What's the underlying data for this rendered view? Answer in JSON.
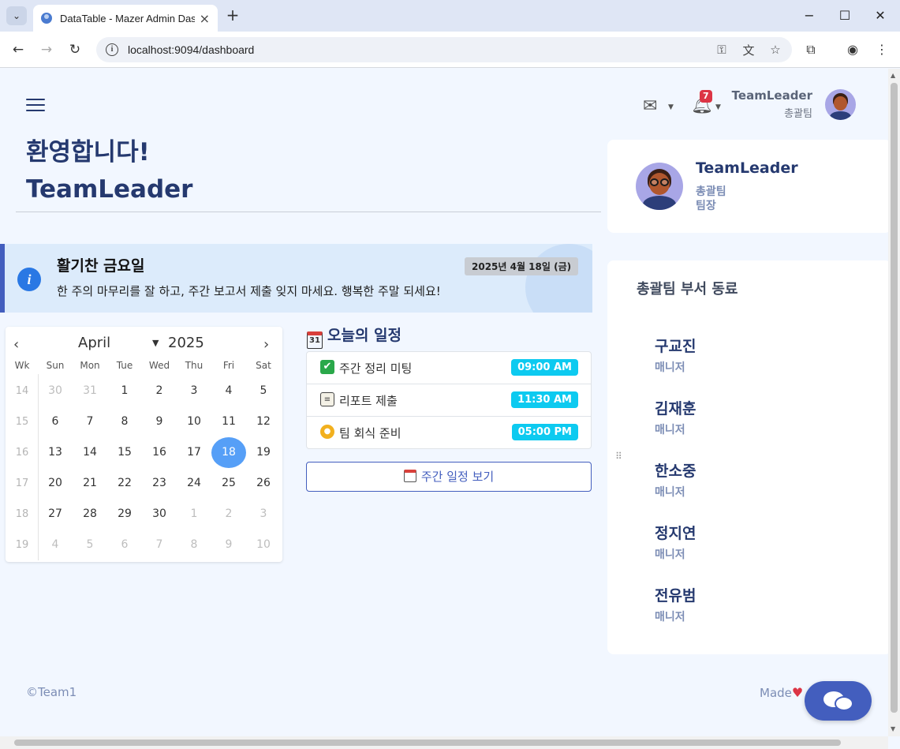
{
  "browser": {
    "tab_title": "DataTable - Mazer Admin Dashboard",
    "url": "localhost:9094/dashboard"
  },
  "header": {
    "notification_count": "7",
    "user_name": "TeamLeader",
    "user_team": "총괄팀"
  },
  "welcome": {
    "greeting": "환영합니다!",
    "name": "TeamLeader"
  },
  "alert": {
    "title": "활기찬 금요일",
    "message": "한 주의 마무리를 잘 하고, 주간 보고서 제출 잊지 마세요. 행복한 주말 되세요!",
    "date": "2025년 4월 18일 (금)"
  },
  "calendar": {
    "month": "April",
    "year": "2025",
    "headers": [
      "Wk",
      "Sun",
      "Mon",
      "Tue",
      "Wed",
      "Thu",
      "Fri",
      "Sat"
    ],
    "selected_day": "18",
    "weeks": [
      {
        "wk": "14",
        "days": [
          [
            "30",
            true
          ],
          [
            "31",
            true
          ],
          [
            "1",
            false
          ],
          [
            "2",
            false
          ],
          [
            "3",
            false
          ],
          [
            "4",
            false
          ],
          [
            "5",
            false
          ]
        ]
      },
      {
        "wk": "15",
        "days": [
          [
            "6",
            false
          ],
          [
            "7",
            false
          ],
          [
            "8",
            false
          ],
          [
            "9",
            false
          ],
          [
            "10",
            false
          ],
          [
            "11",
            false
          ],
          [
            "12",
            false
          ]
        ]
      },
      {
        "wk": "16",
        "days": [
          [
            "13",
            false
          ],
          [
            "14",
            false
          ],
          [
            "15",
            false
          ],
          [
            "16",
            false
          ],
          [
            "17",
            false
          ],
          [
            "18",
            false
          ],
          [
            "19",
            false
          ]
        ]
      },
      {
        "wk": "17",
        "days": [
          [
            "20",
            false
          ],
          [
            "21",
            false
          ],
          [
            "22",
            false
          ],
          [
            "23",
            false
          ],
          [
            "24",
            false
          ],
          [
            "25",
            false
          ],
          [
            "26",
            false
          ]
        ]
      },
      {
        "wk": "18",
        "days": [
          [
            "27",
            false
          ],
          [
            "28",
            false
          ],
          [
            "29",
            false
          ],
          [
            "30",
            false
          ],
          [
            "1",
            true
          ],
          [
            "2",
            true
          ],
          [
            "3",
            true
          ]
        ]
      },
      {
        "wk": "19",
        "days": [
          [
            "4",
            true
          ],
          [
            "5",
            true
          ],
          [
            "6",
            true
          ],
          [
            "7",
            true
          ],
          [
            "8",
            true
          ],
          [
            "9",
            true
          ],
          [
            "10",
            true
          ]
        ]
      }
    ]
  },
  "schedule": {
    "title": "오늘의 일정",
    "title_icon_text": "31",
    "items": [
      {
        "label": "주간 정리 미팅",
        "time": "09:00 AM",
        "icon": "check-icon"
      },
      {
        "label": "리포트 제출",
        "time": "11:30 AM",
        "icon": "document-icon"
      },
      {
        "label": "팀 회식 준비",
        "time": "05:00 PM",
        "icon": "beer-icon"
      }
    ],
    "week_button": "주간 일정 보기"
  },
  "profile": {
    "name": "TeamLeader",
    "team": "총괄팀",
    "role": "팀장"
  },
  "colleagues": {
    "title": "총괄팀 부서 동료",
    "list": [
      {
        "name": "구교진",
        "role": "매니저"
      },
      {
        "name": "김재훈",
        "role": "매니저"
      },
      {
        "name": "한소중",
        "role": "매니저"
      },
      {
        "name": "정지연",
        "role": "매니저"
      },
      {
        "name": "전유범",
        "role": "매니저"
      }
    ]
  },
  "footer": {
    "copyright": "©Team1",
    "made_with": "Made"
  },
  "colors": {
    "primary": "#435ebe",
    "page_bg": "#f2f7ff",
    "info": "#0dcaf0",
    "danger": "#dc3545",
    "calendar_selected": "#569ff7"
  }
}
